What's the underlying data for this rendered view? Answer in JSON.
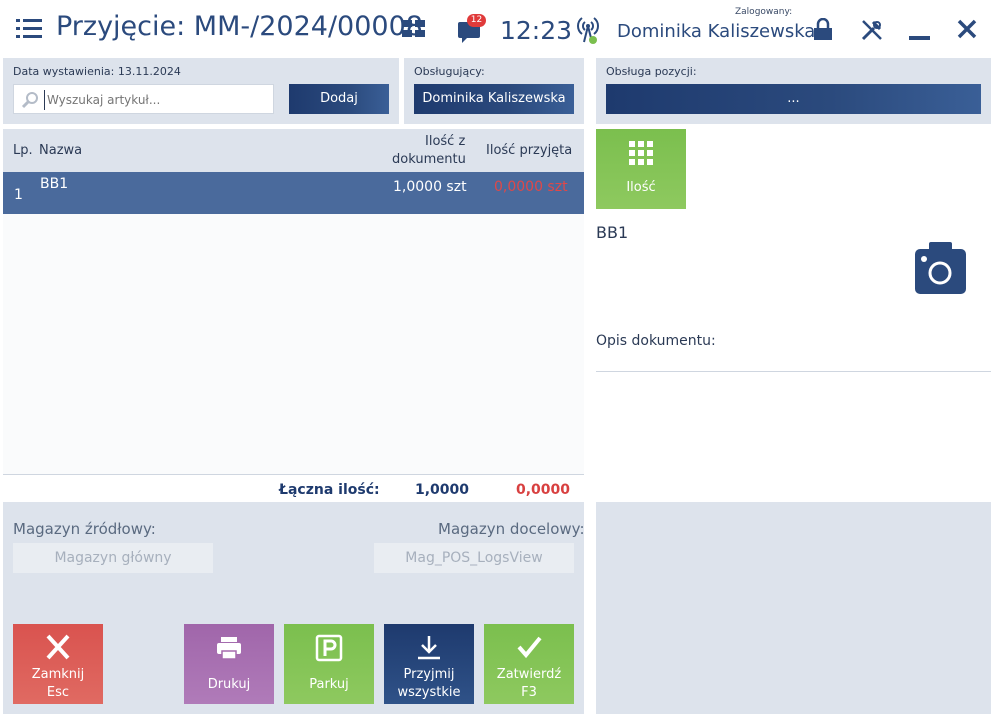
{
  "header": {
    "title": "Przyjęcie: MM-/2024/00008",
    "notification_count": "12",
    "time": "12:23",
    "logged_label": "Zalogowany:",
    "user_name": "Dominika Kaliszewska"
  },
  "search_panel": {
    "issue_date": "Data wystawienia: 13.11.2024",
    "search_placeholder": "Wyszukaj artykuł...",
    "add_label": "Dodaj"
  },
  "operator_panel": {
    "label": "Obsługujący:",
    "value": "Dominika Kaliszewska"
  },
  "position_panel": {
    "label": "Obsługa pozycji:",
    "button_label": "..."
  },
  "table": {
    "headers": {
      "lp": "Lp.",
      "name": "Nazwa",
      "doc_qty_line1": "Ilość z",
      "doc_qty_line2": "dokumentu",
      "received_qty": "Ilość przyjęta"
    },
    "rows": [
      {
        "lp": "1",
        "name": "BB1",
        "doc_qty": "1,0000 szt",
        "received_qty": "0,0000 szt"
      }
    ],
    "total_label": "Łączna ilość:",
    "total_doc_qty": "1,0000",
    "total_received_qty": "0,0000"
  },
  "warehouses": {
    "source_label": "Magazyn źródłowy:",
    "source_value": "Magazyn główny",
    "target_label": "Magazyn docelowy:",
    "target_value": "Mag_POS_LogsView"
  },
  "actions": {
    "close_line1": "Zamknij",
    "close_line2": "Esc",
    "print": "Drukuj",
    "park": "Parkuj",
    "receive_all_line1": "Przyjmij",
    "receive_all_line2": "wszystkie",
    "confirm_line1": "Zatwierdź",
    "confirm_line2": "F3"
  },
  "detail": {
    "qty_tile_label": "Ilość",
    "product_name": "BB1",
    "description_label": "Opis dokumentu:"
  },
  "colors": {
    "navy": "#2b4a7d",
    "panel": "#dde3ec",
    "selected_row": "#4a6a9c",
    "close_red": "#d9534f",
    "print_purple": "#a66cae",
    "green": "#7bbf4e",
    "received_red": "#e04848"
  }
}
